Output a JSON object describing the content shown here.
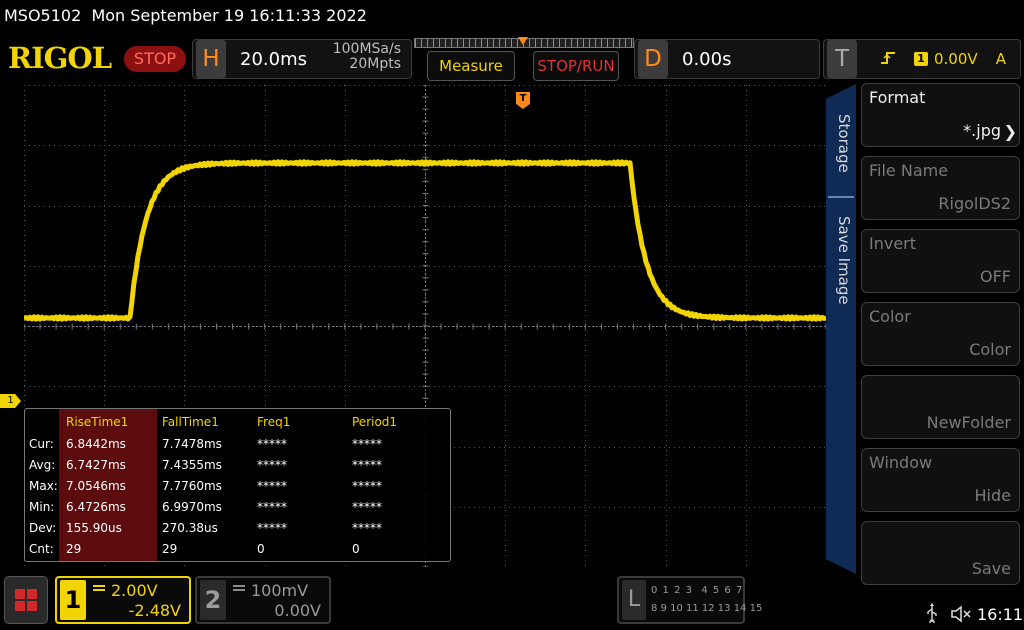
{
  "titlebar": {
    "text": "MSO5102  Mon September 19 16:11:33 2022"
  },
  "logo": {
    "text": "RIGOL"
  },
  "run_status": {
    "label": "STOP"
  },
  "horizontal": {
    "letter": "H",
    "scale": "20.0ms",
    "sample_rate": "100MSa/s",
    "memory_depth": "20Mpts"
  },
  "buttons": {
    "measure": "Measure",
    "stop_run": "STOP/RUN"
  },
  "delay": {
    "letter": "D",
    "value": "0.00s"
  },
  "trigger": {
    "letter": "T",
    "source": "1",
    "level": "0.00V",
    "mode": "A",
    "edge_icon": "rising-edge-icon"
  },
  "markers": {
    "trigger_pos": "T",
    "ch1_ground": "1"
  },
  "measurements": {
    "headers": [
      "RiseTime1",
      "FallTime1",
      "Freq1",
      "Period1"
    ],
    "rows": [
      {
        "label": "Cur:",
        "values": [
          "6.8442ms",
          "7.7478ms",
          "*****",
          "*****"
        ]
      },
      {
        "label": "Avg:",
        "values": [
          "6.7427ms",
          "7.4355ms",
          "*****",
          "*****"
        ]
      },
      {
        "label": "Max:",
        "values": [
          "7.0546ms",
          "7.7760ms",
          "*****",
          "*****"
        ]
      },
      {
        "label": "Min:",
        "values": [
          "6.4726ms",
          "6.9970ms",
          "*****",
          "*****"
        ]
      },
      {
        "label": "Dev:",
        "values": [
          "155.90us",
          "270.38us",
          "*****",
          "*****"
        ]
      },
      {
        "label": "Cnt:",
        "values": [
          "29",
          "29",
          "0",
          "0"
        ]
      }
    ]
  },
  "menu": {
    "tabs": [
      "Storage",
      "Save Image"
    ],
    "items": [
      {
        "caption": "Format",
        "value": "*.jpg",
        "enabled": true
      },
      {
        "caption": "File Name",
        "value": "RigolDS2",
        "enabled": false
      },
      {
        "caption": "Invert",
        "value": "OFF",
        "enabled": false
      },
      {
        "caption": "Color",
        "value": "Color",
        "enabled": false
      },
      {
        "caption": "",
        "value": "NewFolder",
        "enabled": false
      },
      {
        "caption": "Window",
        "value": "Hide",
        "enabled": false
      },
      {
        "caption": "",
        "value": "Save",
        "enabled": false
      }
    ]
  },
  "channels": {
    "ch1": {
      "number": "1",
      "scale": "2.00V",
      "offset": "-2.48V"
    },
    "ch2": {
      "number": "2",
      "scale": "100mV",
      "offset": "0.00V"
    }
  },
  "logic": {
    "letter": "L",
    "row1": "0 1 2 3  4 5 6 7",
    "row2": "8 9 10 11 12 13 14 15"
  },
  "status": {
    "time": "16:11"
  },
  "colors": {
    "ch1": "#f2d400",
    "accent_orange": "#ff8a1a",
    "stop_red": "#8c1010",
    "menu_blue": "#0f2a55"
  }
}
